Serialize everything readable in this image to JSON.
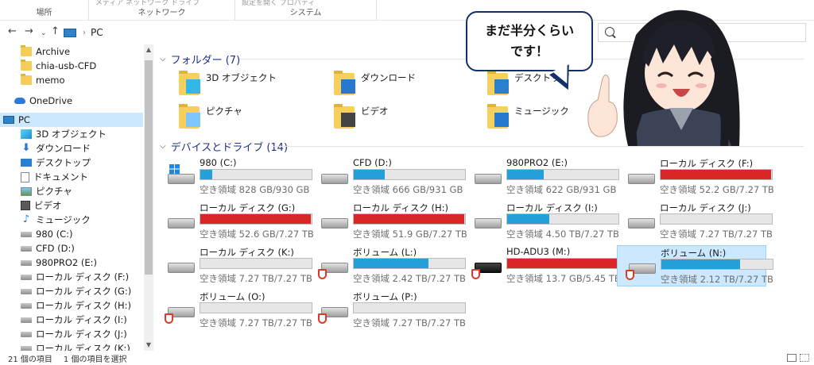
{
  "ribbon": {
    "groups": [
      {
        "label": "場所",
        "cut": "場所"
      },
      {
        "label": "ネットワーク",
        "cut": "メディア  ネットワーク ドライブ"
      },
      {
        "label": "システム",
        "cut": "設定を開く  プロパティ"
      }
    ]
  },
  "address": {
    "path": "PC"
  },
  "sidebar": {
    "items": [
      {
        "label": "Archive",
        "icon": "folder-icon"
      },
      {
        "label": "chia-usb-CFD",
        "icon": "folder-icon"
      },
      {
        "label": "memo",
        "icon": "folder-icon"
      },
      {
        "label": "OneDrive",
        "icon": "cloud-icon"
      },
      {
        "label": "PC",
        "icon": "pc-icon"
      },
      {
        "label": "3D オブジェクト",
        "icon": "cube-icon"
      },
      {
        "label": "ダウンロード",
        "icon": "download-icon"
      },
      {
        "label": "デスクトップ",
        "icon": "desktop-icon"
      },
      {
        "label": "ドキュメント",
        "icon": "document-icon"
      },
      {
        "label": "ピクチャ",
        "icon": "picture-icon"
      },
      {
        "label": "ビデオ",
        "icon": "video-icon"
      },
      {
        "label": "ミュージック",
        "icon": "music-icon"
      },
      {
        "label": "980 (C:)",
        "icon": "drive-icon"
      },
      {
        "label": "CFD (D:)",
        "icon": "drive-icon"
      },
      {
        "label": "980PRO2 (E:)",
        "icon": "drive-icon"
      },
      {
        "label": "ローカル ディスク (F:)",
        "icon": "drive-icon"
      },
      {
        "label": "ローカル ディスク (G:)",
        "icon": "drive-icon"
      },
      {
        "label": "ローカル ディスク (H:)",
        "icon": "drive-icon"
      },
      {
        "label": "ローカル ディスク (I:)",
        "icon": "drive-icon"
      },
      {
        "label": "ローカル ディスク (J:)",
        "icon": "drive-icon"
      },
      {
        "label": "ローカル ディスク (K:)",
        "icon": "drive-icon"
      }
    ]
  },
  "folders_header": "フォルダー (7)",
  "folders": [
    {
      "name": "3D オブジェクト",
      "icon": "cube-icon"
    },
    {
      "name": "ダウンロード",
      "icon": "download-icon"
    },
    {
      "name": "デスクトップ",
      "icon": "desktop-icon"
    },
    {
      "name": "ピクチャ",
      "icon": "picture-icon"
    },
    {
      "name": "ビデオ",
      "icon": "video-icon"
    },
    {
      "name": "ミュージック",
      "icon": "music-icon"
    }
  ],
  "drives_header": "デバイスとドライブ (14)",
  "drives": [
    {
      "name": "980 (C:)",
      "free": "空き領域 828 GB/930 GB",
      "used": 0.11,
      "color": "#26a0da",
      "icon": "windows-drive-icon"
    },
    {
      "name": "CFD (D:)",
      "free": "空き領域 666 GB/931 GB",
      "used": 0.28,
      "color": "#26a0da",
      "icon": "drive-icon"
    },
    {
      "name": "980PRO2 (E:)",
      "free": "空き領域 622 GB/931 GB",
      "used": 0.33,
      "color": "#26a0da",
      "icon": "drive-icon"
    },
    {
      "name": "ローカル ディスク (F:)",
      "free": "空き領域 52.2 GB/7.27 TB",
      "used": 0.99,
      "color": "#da2626",
      "icon": "drive-icon"
    },
    {
      "name": "ローカル ディスク (G:)",
      "free": "空き領域 52.6 GB/7.27 TB",
      "used": 0.99,
      "color": "#da2626",
      "icon": "drive-icon"
    },
    {
      "name": "ローカル ディスク (H:)",
      "free": "空き領域 51.9 GB/7.27 TB",
      "used": 0.99,
      "color": "#da2626",
      "icon": "drive-icon"
    },
    {
      "name": "ローカル ディスク (I:)",
      "free": "空き領域 4.50 TB/7.27 TB",
      "used": 0.38,
      "color": "#26a0da",
      "icon": "drive-icon"
    },
    {
      "name": "ローカル ディスク (J:)",
      "free": "空き領域 7.27 TB/7.27 TB",
      "used": 0.0,
      "color": "#26a0da",
      "icon": "drive-icon"
    },
    {
      "name": "ローカル ディスク (K:)",
      "free": "空き領域 7.27 TB/7.27 TB",
      "used": 0.0,
      "color": "#26a0da",
      "icon": "drive-icon"
    },
    {
      "name": "ボリューム (L:)",
      "free": "空き領域 2.42 TB/7.27 TB",
      "used": 0.67,
      "color": "#26a0da",
      "icon": "shield-drive-icon"
    },
    {
      "name": "HD-ADU3 (M:)",
      "free": "空き領域 13.7 GB/5.45 TB",
      "used": 0.99,
      "color": "#da2626",
      "icon": "external-drive-icon"
    },
    {
      "name": "ボリューム (N:)",
      "free": "空き領域 2.12 TB/7.27 TB",
      "used": 0.71,
      "color": "#26a0da",
      "icon": "shield-drive-icon",
      "selected": true
    },
    {
      "name": "ボリューム (O:)",
      "free": "空き領域 7.27 TB/7.27 TB",
      "used": 0.0,
      "color": "#26a0da",
      "icon": "shield-drive-icon"
    },
    {
      "name": "ボリューム (P:)",
      "free": "空き領域 7.27 TB/7.27 TB",
      "used": 0.0,
      "color": "#26a0da",
      "icon": "shield-drive-icon"
    }
  ],
  "status": {
    "count": "21 個の項目",
    "selected": "1 個の項目を選択"
  },
  "overlay": {
    "line1": "まだ半分くらい",
    "line2": "です！"
  }
}
